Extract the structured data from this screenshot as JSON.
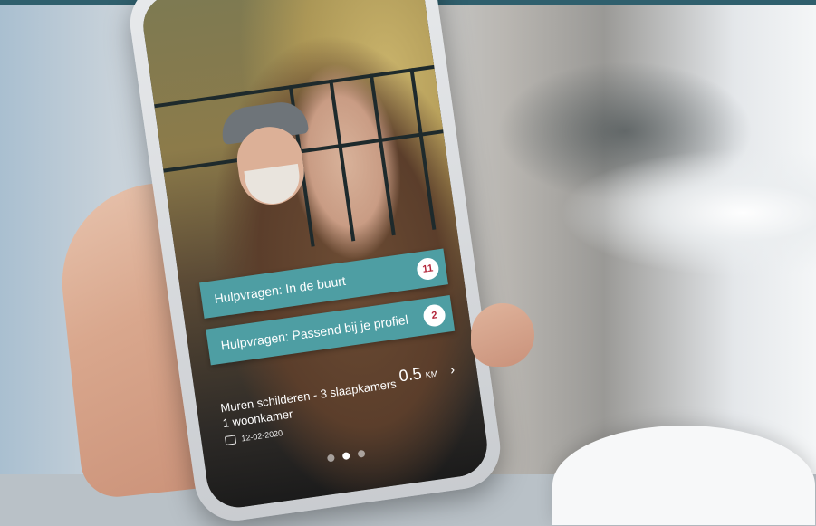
{
  "cards": [
    {
      "label": "Hulpvragen: In de buurt",
      "count": "11"
    },
    {
      "label": "Hulpvragen: Passend bij je profiel",
      "count": "2"
    }
  ],
  "task": {
    "title_line1": "Muren schilderen - 3 slaapkamers",
    "title_line2": "1 woonkamer",
    "date": "12-02-2020",
    "distance": "0.5",
    "unit": "KM",
    "chevron": "›"
  },
  "pager": {
    "total": 3,
    "active": 1
  },
  "colors": {
    "card": "#4e9ea3",
    "badge_text": "#b3263a",
    "topbar": "#2f5f6d"
  },
  "icons": {
    "date": "calendar-icon",
    "next": "chevron-right-icon"
  }
}
